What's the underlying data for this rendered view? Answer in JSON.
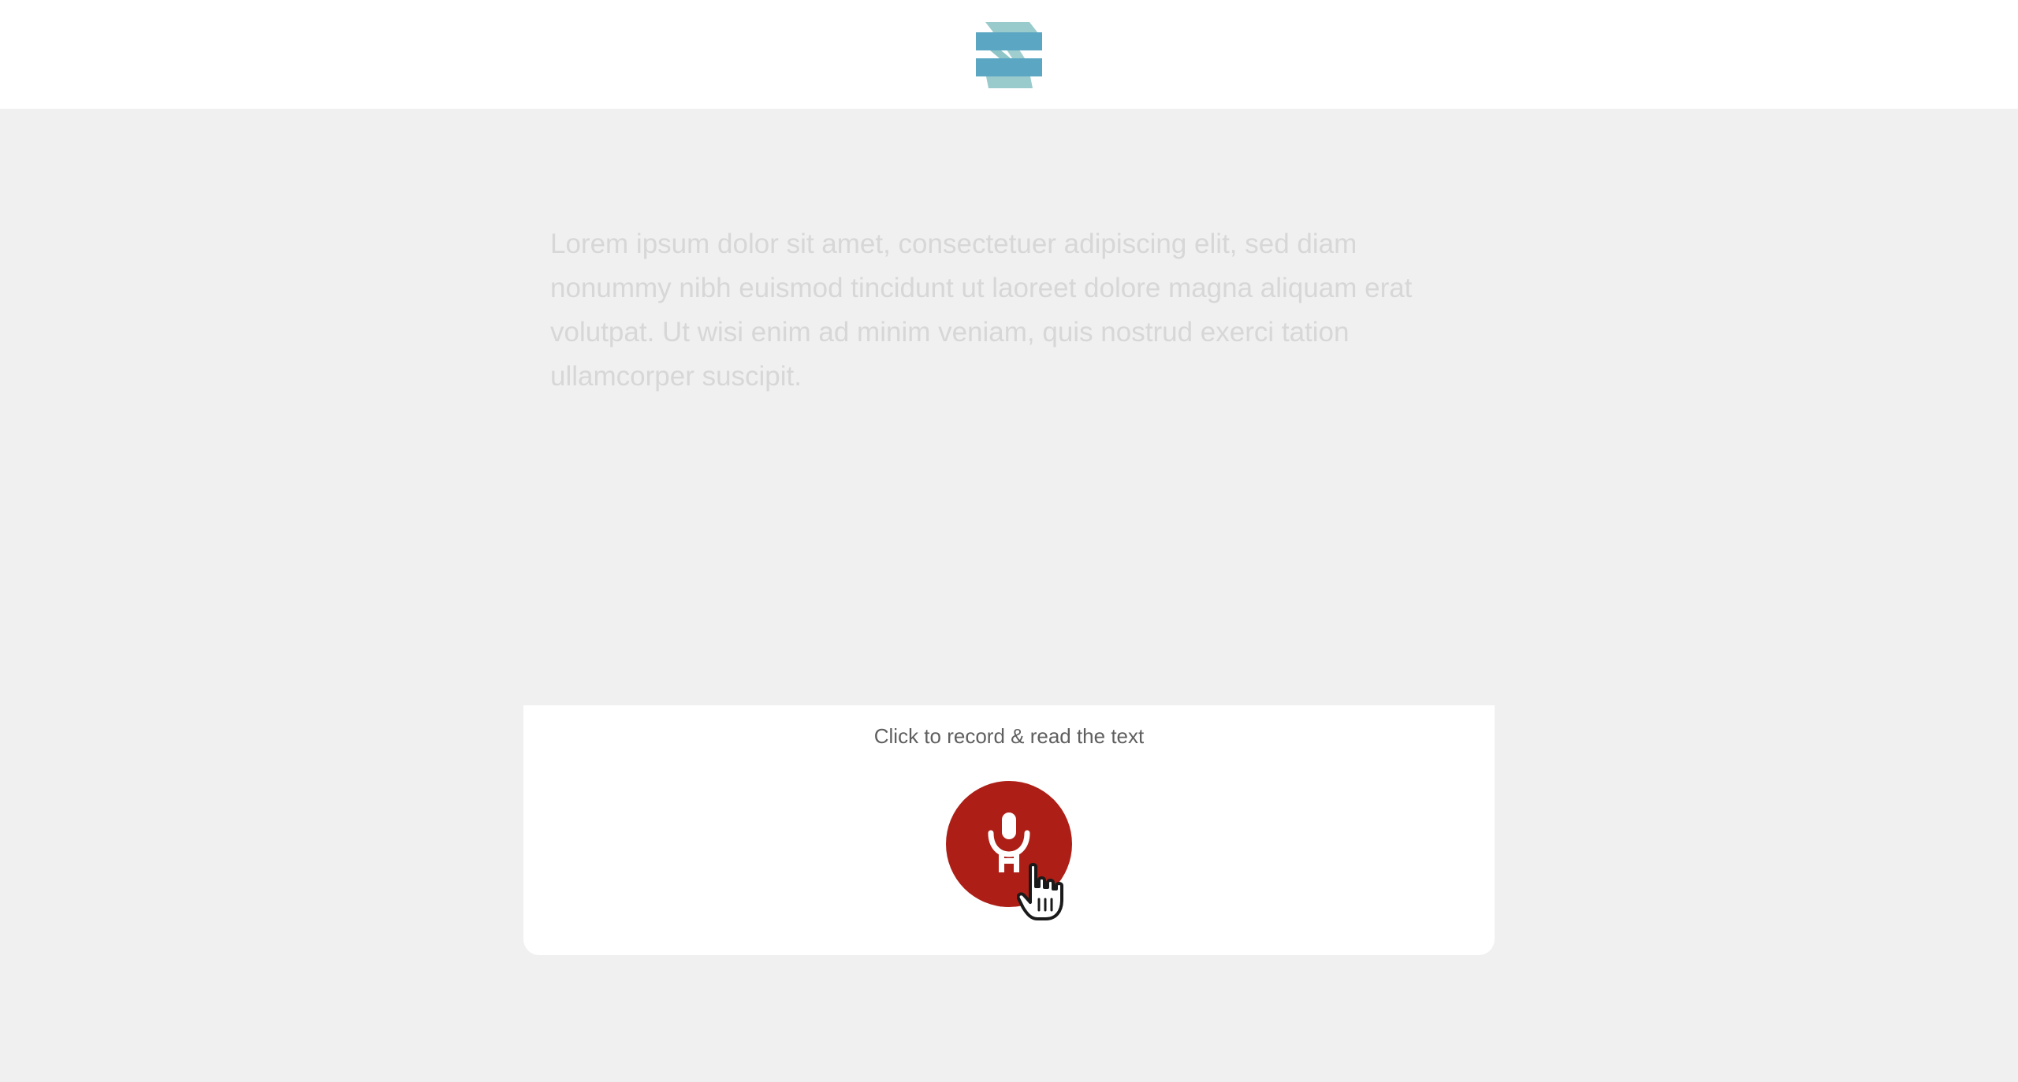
{
  "header": {
    "logo": "stacked-bars-logo-icon"
  },
  "main": {
    "passage": "Lorem ipsum dolor sit amet, consectetuer adipiscing elit, sed diam nonummy nibh euismod tincidunt ut laoreet dolore magna aliquam erat volutpat. Ut wisi enim ad minim veniam, quis nostrud exerci tation ullamcorper suscipit."
  },
  "recorder": {
    "instruction": "Click to record & read the text",
    "button_icon": "microphone-icon",
    "button_color": "#ad1f16"
  },
  "colors": {
    "background": "#f0f0f0",
    "header": "#ffffff",
    "logo_blue": "#5aa6c3",
    "logo_teal": "#8fc5c6",
    "passage_text": "#d7d7d7",
    "instruction_text": "#5f5f5f"
  },
  "pointer": {
    "icon": "hand-pointer-icon"
  }
}
